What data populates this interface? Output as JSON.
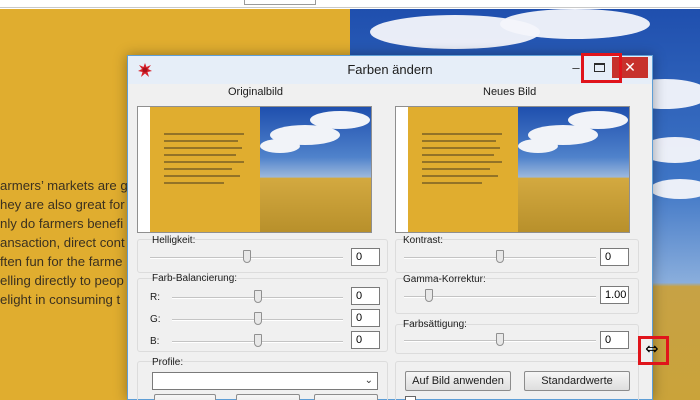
{
  "background": {
    "text_lines": [
      "armers’ markets are g",
      "hey are also great for",
      "nly do farmers benefi",
      "ansaction, direct cont",
      "ften fun for the farme",
      "elling directly to peop",
      "elight in consuming t"
    ]
  },
  "dialog": {
    "title": "Farben ändern",
    "app_icon": "paint-splash-icon",
    "minimize_glyph": "–",
    "close_glyph": "✕",
    "original_label": "Originalbild",
    "new_label": "Neues Bild"
  },
  "adjust": {
    "helligkeit": {
      "label": "Helligkeit:",
      "value": "0",
      "level": 0.5
    },
    "kontrast": {
      "label": "Kontrast:",
      "value": "0",
      "level": 0.5
    },
    "farb_balancierung": {
      "label": "Farb-Balancierung:",
      "channels": [
        {
          "label": "R:",
          "value": "0",
          "level": 0.5
        },
        {
          "label": "G:",
          "value": "0",
          "level": 0.5
        },
        {
          "label": "B:",
          "value": "0",
          "level": 0.5
        }
      ]
    },
    "gamma": {
      "label": "Gamma-Korrektur:",
      "value": "1.00",
      "level": 0.13
    },
    "saettigung": {
      "label": "Farbsättigung:",
      "value": "0",
      "level": 0.5
    }
  },
  "profile": {
    "label": "Profile:",
    "selected": ""
  },
  "buttons": {
    "apply": "Auf Bild anwenden",
    "defaults": "Standardwerte"
  },
  "colors": {
    "close_red": "#c7312c",
    "highlight": "#e0141b",
    "doc_yellow": "#e0ad2f"
  },
  "cursor": "resize-horizontal-icon"
}
